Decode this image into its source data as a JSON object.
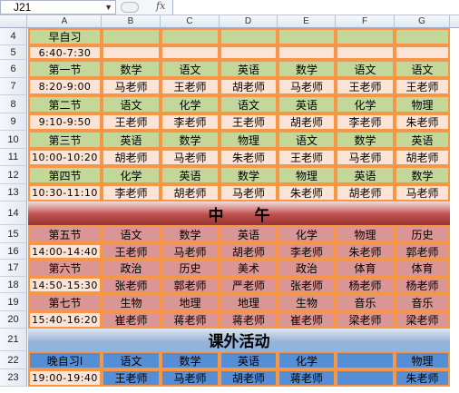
{
  "namebox": "J21",
  "formula_icon": "fx",
  "columns": [
    "A",
    "B",
    "C",
    "D",
    "E",
    "F",
    "G"
  ],
  "rows": [
    {
      "num": "4",
      "type": "header",
      "cells": [
        "早自习",
        "",
        "",
        "",
        "",
        "",
        ""
      ]
    },
    {
      "num": "5",
      "type": "time",
      "cells": [
        "6:40-7:30",
        "",
        "",
        "",
        "",
        "",
        ""
      ]
    },
    {
      "num": "6",
      "type": "header",
      "cells": [
        "第一节",
        "数学",
        "语文",
        "英语",
        "数学",
        "语文",
        "语文"
      ]
    },
    {
      "num": "7",
      "type": "time",
      "cells": [
        "8:20-9:00",
        "马老师",
        "王老师",
        "胡老师",
        "马老师",
        "王老师",
        "王老师"
      ]
    },
    {
      "num": "8",
      "type": "header",
      "cells": [
        "第二节",
        "语文",
        "化学",
        "语文",
        "英语",
        "化学",
        "物理"
      ]
    },
    {
      "num": "9",
      "type": "time",
      "cells": [
        "9:10-9:50",
        "王老师",
        "李老师",
        "王老师",
        "胡老师",
        "李老师",
        "朱老师"
      ]
    },
    {
      "num": "10",
      "type": "header",
      "cells": [
        "第三节",
        "英语",
        "数学",
        "物理",
        "语文",
        "数学",
        "英语"
      ]
    },
    {
      "num": "11",
      "type": "time",
      "cells": [
        "10:00-10:20",
        "胡老师",
        "马老师",
        "朱老师",
        "王老师",
        "马老师",
        "胡老师"
      ]
    },
    {
      "num": "12",
      "type": "header",
      "cells": [
        "第四节",
        "化学",
        "英语",
        "数学",
        "物理",
        "英语",
        "数学"
      ]
    },
    {
      "num": "13",
      "type": "time",
      "cells": [
        "10:30-11:10",
        "李老师",
        "胡老师",
        "马老师",
        "朱老师",
        "胡老师",
        "马老师"
      ]
    },
    {
      "num": "14",
      "type": "banner",
      "text": "中　　午"
    },
    {
      "num": "15",
      "type": "pm-header",
      "cells": [
        "第五节",
        "语文",
        "数学",
        "英语",
        "化学",
        "物理",
        "历史"
      ]
    },
    {
      "num": "16",
      "type": "pm-time",
      "cells": [
        "14:00-14:40",
        "王老师",
        "马老师",
        "胡老师",
        "李老师",
        "朱老师",
        "郭老师"
      ]
    },
    {
      "num": "17",
      "type": "pm-header",
      "cells": [
        "第六节",
        "政治",
        "历史",
        "美术",
        "政治",
        "体育",
        "体育"
      ]
    },
    {
      "num": "18",
      "type": "pm-time",
      "cells": [
        "14:50-15:30",
        "张老师",
        "郭老师",
        "严老师",
        "张老师",
        "杨老师",
        "杨老师"
      ]
    },
    {
      "num": "19",
      "type": "pm-header",
      "cells": [
        "第七节",
        "生物",
        "地理",
        "地理",
        "生物",
        "音乐",
        "音乐"
      ]
    },
    {
      "num": "20",
      "type": "pm-time",
      "cells": [
        "15:40-16:20",
        "崔老师",
        "蒋老师",
        "蒋老师",
        "崔老师",
        "梁老师",
        "梁老师"
      ]
    },
    {
      "num": "21",
      "type": "banner2",
      "text": "课外活动"
    },
    {
      "num": "22",
      "type": "blue",
      "cells": [
        "晚自习Ⅰ",
        "语文",
        "数学",
        "英语",
        "化学",
        "",
        "物理"
      ]
    },
    {
      "num": "23",
      "type": "blue-time",
      "cells": [
        "19:00-19:40",
        "王老师",
        "马老师",
        "胡老师",
        "蒋老师",
        "",
        "朱老师"
      ]
    }
  ]
}
